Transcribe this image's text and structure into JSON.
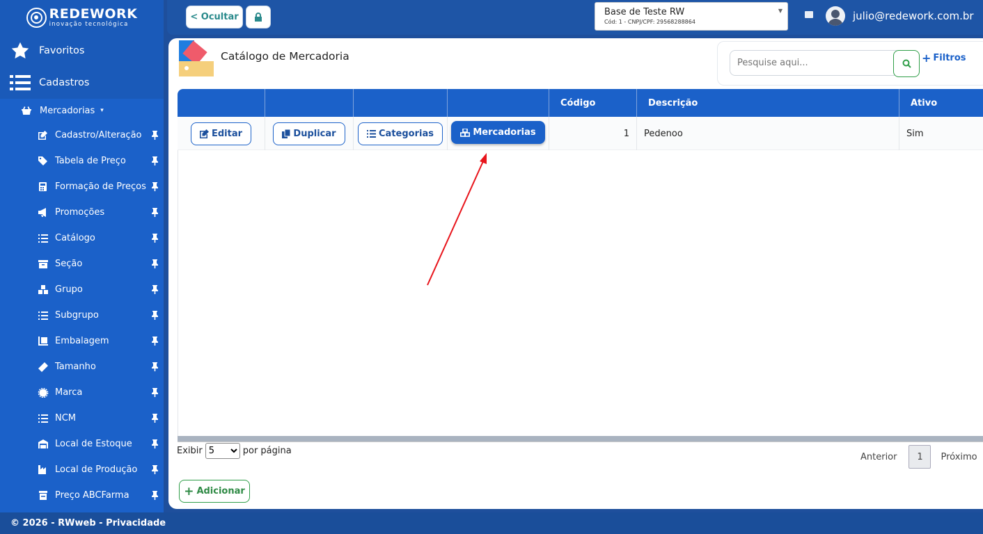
{
  "sidebar": {
    "brand": "REDEWORK",
    "tagline": "inovação tecnológica",
    "favoritos": "Favoritos",
    "cadastros": "Cadastros",
    "submenu": "Mercadorias",
    "items": [
      {
        "label": "Cadastro/Alteração",
        "icon": "edit-icon"
      },
      {
        "label": "Tabela de Preço",
        "icon": "tag-icon"
      },
      {
        "label": "Formação de Preços",
        "icon": "calculator-icon"
      },
      {
        "label": "Promoções",
        "icon": "megaphone-icon"
      },
      {
        "label": "Catálogo",
        "icon": "list-icon"
      },
      {
        "label": "Seção",
        "icon": "archive-icon"
      },
      {
        "label": "Grupo",
        "icon": "boxes-icon"
      },
      {
        "label": "Subgrupo",
        "icon": "list-icon"
      },
      {
        "label": "Embalagem",
        "icon": "dolly-icon"
      },
      {
        "label": "Tamanho",
        "icon": "ruler-icon"
      },
      {
        "label": "Marca",
        "icon": "certificate-icon"
      },
      {
        "label": "NCM",
        "icon": "list-icon"
      },
      {
        "label": "Local de Estoque",
        "icon": "warehouse-icon"
      },
      {
        "label": "Local de Produção",
        "icon": "industry-icon"
      },
      {
        "label": "Preço ABCFarma",
        "icon": "prescription-bottle-icon"
      }
    ]
  },
  "topbar": {
    "hide_label": "< Ocultar",
    "company_name": "Base de Teste RW",
    "company_sub": "Cód: 1 - CNPJ/CPF: 29568288864",
    "user_email": "julio@redework.com.br"
  },
  "page": {
    "title": "Catálogo de Mercadoria",
    "search_placeholder": "Pesquise aqui...",
    "filters_label": "Filtros"
  },
  "table": {
    "columns": [
      "Código",
      "Descrição",
      "Ativo"
    ],
    "row": {
      "edit": "Editar",
      "duplicate": "Duplicar",
      "categories": "Categorias",
      "products": "Mercadorias",
      "codigo": "1",
      "descricao": "Pedenoo",
      "ativo": "Sim"
    }
  },
  "pagination": {
    "show": "Exibir",
    "per_page_value": "5",
    "per_page": "por página",
    "prev": "Anterior",
    "current": "1",
    "next": "Próximo"
  },
  "add_label": "Adicionar",
  "footer": "© 2026 - RWweb - Privacidade",
  "colors": {
    "primary": "#1b61c9",
    "success": "#2f9e48",
    "annotation": "#e8141b"
  }
}
